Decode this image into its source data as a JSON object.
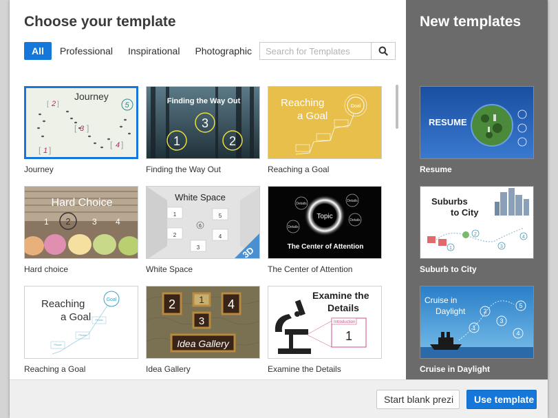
{
  "main": {
    "title": "Choose your template",
    "filters": [
      "All",
      "Professional",
      "Inspirational",
      "Photographic"
    ],
    "search_placeholder": "Search for Templates",
    "templates": [
      {
        "label": "Journey",
        "thumb": {
          "title": "Journey",
          "n1": "2",
          "n2": "5",
          "n3": "3",
          "n4": "1",
          "n5": "4"
        }
      },
      {
        "label": "Finding the Way Out",
        "thumb": {
          "title": "Finding the Way Out",
          "n1": "1",
          "n2": "3",
          "n3": "2"
        }
      },
      {
        "label": "Reaching a Goal",
        "thumb": {
          "title": "Reaching\na Goal",
          "goal": "Goal",
          "phase": "Phase"
        }
      },
      {
        "label": "Hard choice",
        "thumb": {
          "title": "Hard Choice",
          "n1": "1",
          "n2": "2",
          "n3": "3",
          "n4": "4"
        }
      },
      {
        "label": "White Space",
        "thumb": {
          "title": "White Space",
          "badge": "3D",
          "topic": "Topic",
          "n1": "1",
          "n2": "5",
          "n3": "6",
          "n4": "2",
          "n5": "4",
          "n6": "3"
        }
      },
      {
        "label": "The Center of Attention",
        "thumb": {
          "title": "The Center of Attention",
          "center": "Topic",
          "details": "Details"
        }
      },
      {
        "label": "Reaching a Goal",
        "thumb": {
          "title": "Reaching\na Goal",
          "goal": "Goal",
          "phase": "Phase"
        }
      },
      {
        "label": "Idea Gallery",
        "thumb": {
          "title": "Idea Gallery",
          "n1": "2",
          "n2": "1",
          "n3": "4",
          "n4": "3"
        }
      },
      {
        "label": "Examine the Details",
        "thumb": {
          "title": "Examine the Details",
          "intro": "Introduction",
          "n1": "1"
        }
      }
    ]
  },
  "side": {
    "title": "New templates",
    "templates": [
      {
        "label": "Resume",
        "thumb": {
          "title": "RESUME"
        }
      },
      {
        "label": "Suburb to City",
        "thumb": {
          "title": "Suburbs\nto City",
          "n1": "1",
          "n2": "2",
          "n3": "3",
          "n4": "4"
        }
      },
      {
        "label": "Cruise in Daylight",
        "thumb": {
          "title": "Cruise in\nDaylight",
          "n1": "1",
          "n2": "2",
          "n3": "3",
          "n4": "4",
          "n5": "5"
        }
      }
    ]
  },
  "footer": {
    "blank_label": "Start blank prezi",
    "use_label": "Use template"
  },
  "colors": {
    "accent": "#1477d9",
    "side_bg": "#6b6b6b",
    "footer_bg": "#efefef"
  }
}
